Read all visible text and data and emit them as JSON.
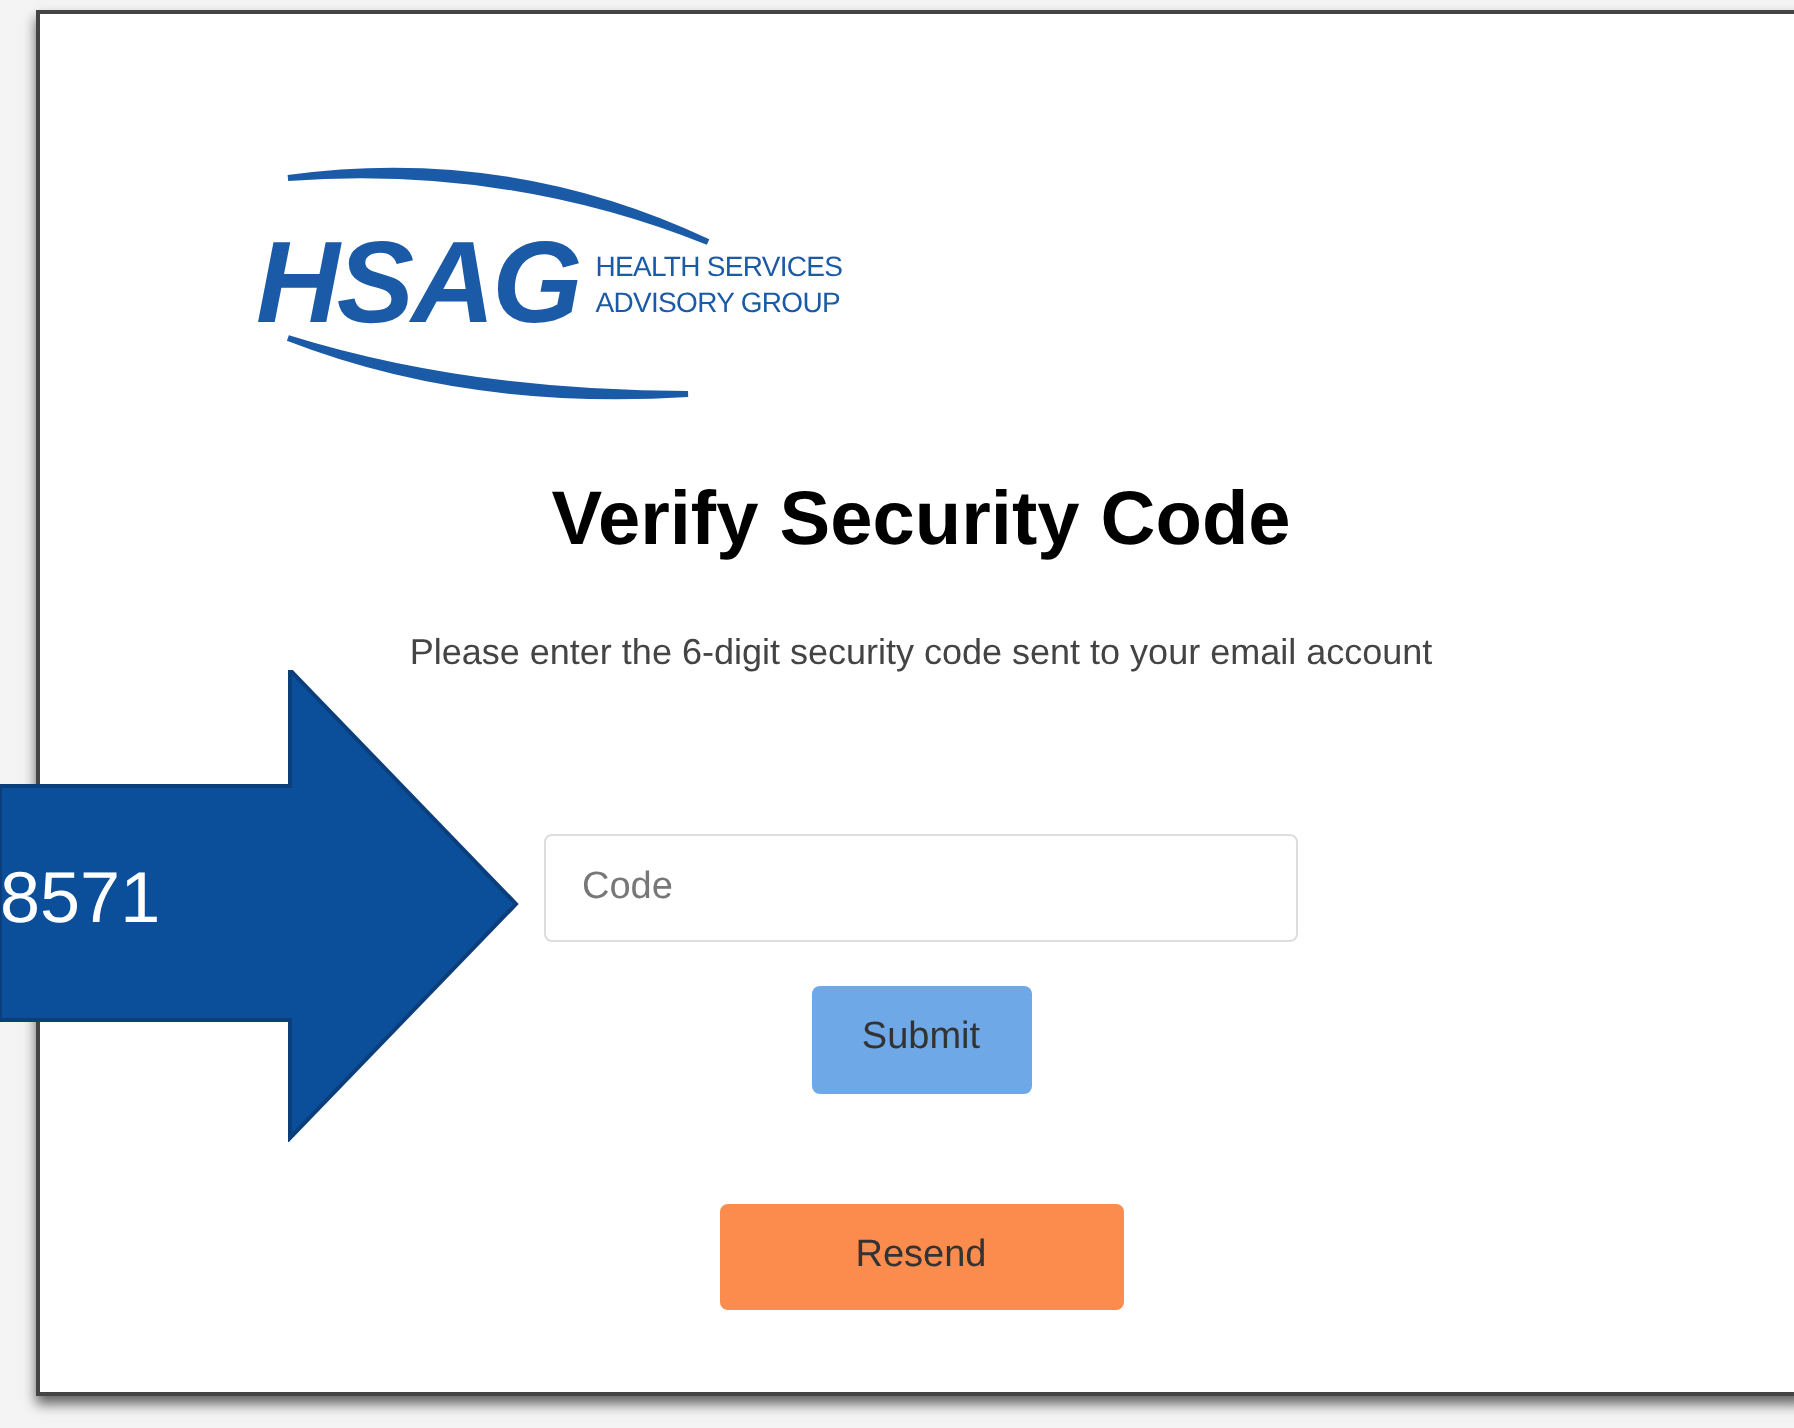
{
  "logo": {
    "mark": "HSAG",
    "name_line_1": "HEALTH SERVICES",
    "name_line_2": "ADVISORY GROUP"
  },
  "title": "Verify Security Code",
  "instructions": "Please enter the 6-digit security code sent to your email account",
  "code_field": {
    "placeholder": "Code"
  },
  "buttons": [
    {
      "kind": "submit",
      "label": "Submit"
    },
    {
      "kind": "resend",
      "label": "Resend"
    }
  ],
  "callout": {
    "text": "8571"
  }
}
